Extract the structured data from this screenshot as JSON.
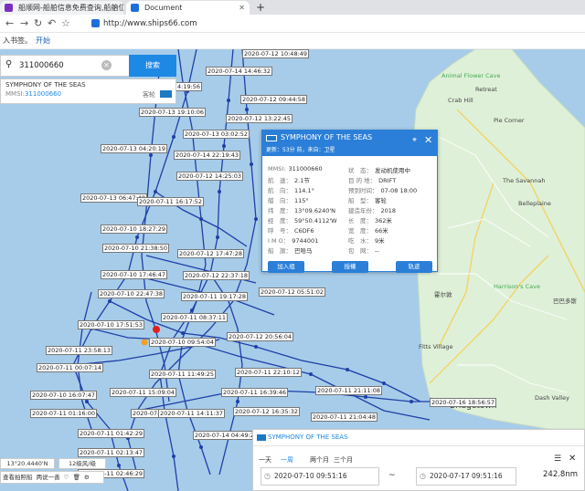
{
  "browser": {
    "tabs": [
      {
        "title": "船顺网-船舶信息免费查询,船舶位"
      },
      {
        "title": "Document"
      }
    ],
    "url": "http://www.ships66.com",
    "bookmarks_prefix": "入书签。",
    "bookmarks_link": "开始"
  },
  "search": {
    "value": "311000660",
    "button": "搜索"
  },
  "result": {
    "name": "SYMPHONY OF THE SEAS",
    "mmsi_label": "MMSI:",
    "mmsi": "311000660",
    "type": "客轮"
  },
  "popup": {
    "title": "SYMPHONY OF THE SEAS",
    "subtitle": "更新：53分 前，来自：卫星",
    "fields_left": [
      {
        "k": "MMSI:",
        "v": "311000660"
      },
      {
        "k": "航　速：",
        "v": "2.1节"
      },
      {
        "k": "航　向：",
        "v": "114.1°"
      },
      {
        "k": "艏　向：",
        "v": "115°"
      },
      {
        "k": "纬　度：",
        "v": "13°09.6240'N"
      },
      {
        "k": "经　度：",
        "v": "59°50.4112'W"
      },
      {
        "k": "呼　号：",
        "v": "C6DF6"
      },
      {
        "k": "I M O：",
        "v": "9744001"
      },
      {
        "k": "船　旗：",
        "v": "巴哈马"
      }
    ],
    "fields_right": [
      {
        "k": "状　态：",
        "v": "发动机使用中"
      },
      {
        "k": "目 的 地：",
        "v": "DRIFT"
      },
      {
        "k": "预到时间：",
        "v": "07-08 18:00"
      },
      {
        "k": "船　型：",
        "v": "客轮"
      },
      {
        "k": "建造年份：",
        "v": "2018"
      },
      {
        "k": "长　度：",
        "v": "362米"
      },
      {
        "k": "宽　度：",
        "v": "66米"
      },
      {
        "k": "吃　水：",
        "v": "9米"
      },
      {
        "k": "包　网：",
        "v": "--"
      }
    ],
    "buttons": [
      "加入组",
      "授權",
      "轨迹"
    ]
  },
  "track": {
    "title": "SYMPHONY OF THE SEAS",
    "periods": [
      "一天",
      "一周",
      "两个月",
      "三个月"
    ],
    "active_period": "一周",
    "from": "2020-07-10 09:51:16",
    "tilde": "~",
    "to": "2020-07-17 09:51:16",
    "distance": "242.8nm"
  },
  "coord": "13°20.4440'N",
  "wind": "12级风/级",
  "tools": [
    "查看拍照船",
    "两说一善"
  ],
  "timestamps": [
    "2020-07-12 10:48:49",
    "2020-07-14 14:46:32",
    "4:19:56",
    "2020-07-12 09:44:58",
    "2020-07-13 19:10:06",
    "2020-07-12 13:22:45",
    "2020-07-13 03:02:52",
    "2020-07-14 22:19:43",
    "2020-07-13 04:20:19",
    "2020-07-12 14:25:03",
    "2020-07-13 06:47:40",
    "2020-07-11 16:17:52",
    "2020-07-10 18:27:29",
    "2020-07-10 21:38:50",
    "2020-07-12 17:47:28",
    "2020-07-10 17:46:47",
    "2020-07-12 22:37:18",
    "2020-07-10 22:47:38",
    "2020-07-11 19:17:28",
    "2020-07-12 05:51:02",
    "2020-07-11 08:37:11",
    "2020-07-10 17:51:53",
    "2020-07-11 23:58:13",
    "2020-07-10 09:54:04",
    "2020-07-12 20:56:04",
    "2020-07-11 00:07:14",
    "2020-07-11 11:49:25",
    "2020-07-11 22:10:12",
    "2020-07-11 15:09:04",
    "2020-07-11 16:39:46",
    "2020-07-10 16:07:47",
    "2020-07-11 21:11:08",
    "2020-07-11 01:16:00",
    "2020-07-11 15:09:04",
    "2020-07-11 14:11:37",
    "2020-07-12 16:35:32",
    "2020-07-11 01:42:29",
    "2020-07-11 21:04:48",
    "2020-07-11 02:13:47",
    "2020-07-14 04:49:29",
    "2020-07-11 02:46:29",
    "2020-07-16 18:56:57"
  ],
  "places": {
    "animal_flower_cave": "Animal Flower Cave",
    "crab_hill": "Crab Hill",
    "retreat": "Retreat",
    "pie_corner": "Pie Corner",
    "the_savannah": "The Savannah",
    "belleplaine": "Belleplaine",
    "harrisons_cave": "Harrison's Cave",
    "fitts_village": "Fitts Village",
    "bridgetown": "Bridgetown",
    "dash_valley": "Dash Valley",
    "harrisons_cave_cn": "巴巴多斯",
    "holetown_cn": "霍尔敦"
  },
  "colors": {
    "sea": "#a6cce9",
    "land": "#dff0d8",
    "track": "#1f3fa8",
    "accent": "#1e88e5"
  }
}
